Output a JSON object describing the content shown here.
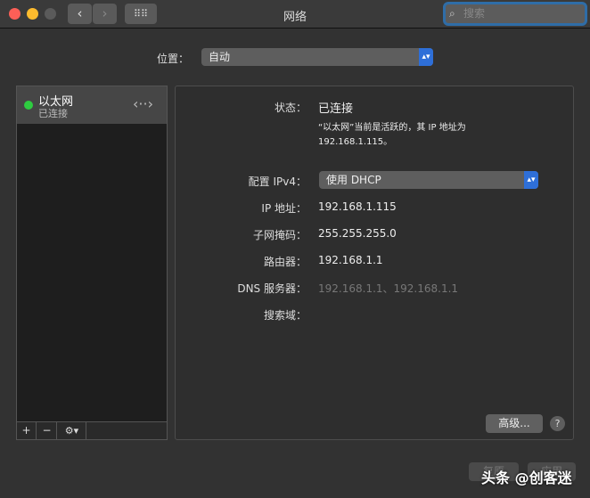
{
  "window": {
    "title": "网络",
    "search_placeholder": "搜索"
  },
  "location": {
    "label": "位置：",
    "value": "自动"
  },
  "sidebar": {
    "items": [
      {
        "name": "以太网",
        "status": "已连接",
        "status_color": "#2ecc40"
      }
    ],
    "add": "+",
    "remove": "−",
    "gear": "⚙▾"
  },
  "detail": {
    "status_label": "状态：",
    "status_value": "已连接",
    "status_desc_1": "“以太网”当前是活跃的，其 IP 地址为",
    "status_desc_2": "192.168.1.115。",
    "ipv4_label": "配置 IPv4：",
    "ipv4_value": "使用 DHCP",
    "ip_label": "IP 地址：",
    "ip_value": "192.168.1.115",
    "mask_label": "子网掩码：",
    "mask_value": "255.255.255.0",
    "router_label": "路由器：",
    "router_value": "192.168.1.1",
    "dns_label": "DNS 服务器：",
    "dns_value": "192.168.1.1、192.168.1.1",
    "domain_label": "搜索域：",
    "advanced": "高级...",
    "help": "?"
  },
  "footer": {
    "revert": "复原",
    "apply": "应用"
  },
  "watermark": "头条 @创客迷"
}
